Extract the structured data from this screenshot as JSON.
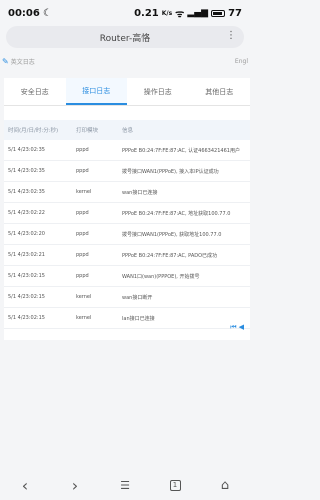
{
  "status_bar": {
    "time": "00:06",
    "moon": "☾",
    "network_speed": "0.21",
    "speed_unit": "K/s",
    "battery": "77"
  },
  "browser": {
    "url_title": "Router-高恪",
    "menu_glyph": "⋮"
  },
  "subheader": {
    "left_text": "英文日志",
    "right_text": "Engl"
  },
  "tabs": [
    {
      "label": "安全日志",
      "active": false
    },
    {
      "label": "接口日志",
      "active": true
    },
    {
      "label": "操作日志",
      "active": false
    },
    {
      "label": "其他日志",
      "active": false
    }
  ],
  "table": {
    "headers": [
      "时间(月/日/时:分:秒)",
      "打印模块",
      "信息"
    ],
    "rows": [
      [
        "5/1 4/23:02:35",
        "pppd",
        "PPPoE B0:24:7F:FE:87:AC, 认证4663421461用户"
      ],
      [
        "5/1 4/23:02:35",
        "pppd",
        "拨号接口WAN1(PPPoE), 接入本IP认证成功"
      ],
      [
        "5/1 4/23:02:35",
        "kernel",
        "wan接口已连接"
      ],
      [
        "5/1 4/23:02:22",
        "pppd",
        "PPPoE B0:24:7F:FE:87:AC, 地址获取100.77.0"
      ],
      [
        "5/1 4/23:02:20",
        "pppd",
        "拨号接口WAN1(PPPoE), 获取地址100.77.0"
      ],
      [
        "5/1 4/23:02:21",
        "pppd",
        "PPPoE B0:24:7F:FE:87:AC, PADO已成功"
      ],
      [
        "5/1 4/23:02:15",
        "pppd",
        "WAN1口(wan)(PPPOE), 开始拨号"
      ],
      [
        "5/1 4/23:02:15",
        "kernel",
        "wan接口断开"
      ],
      [
        "5/1 4/23:02:15",
        "kernel",
        "lan接口已连接"
      ]
    ]
  },
  "pager": {
    "first": "⏮",
    "prev": "◀"
  },
  "bottom_nav": {
    "back": "‹",
    "forward": "›",
    "tabs_count": "1",
    "home": "⌂"
  }
}
